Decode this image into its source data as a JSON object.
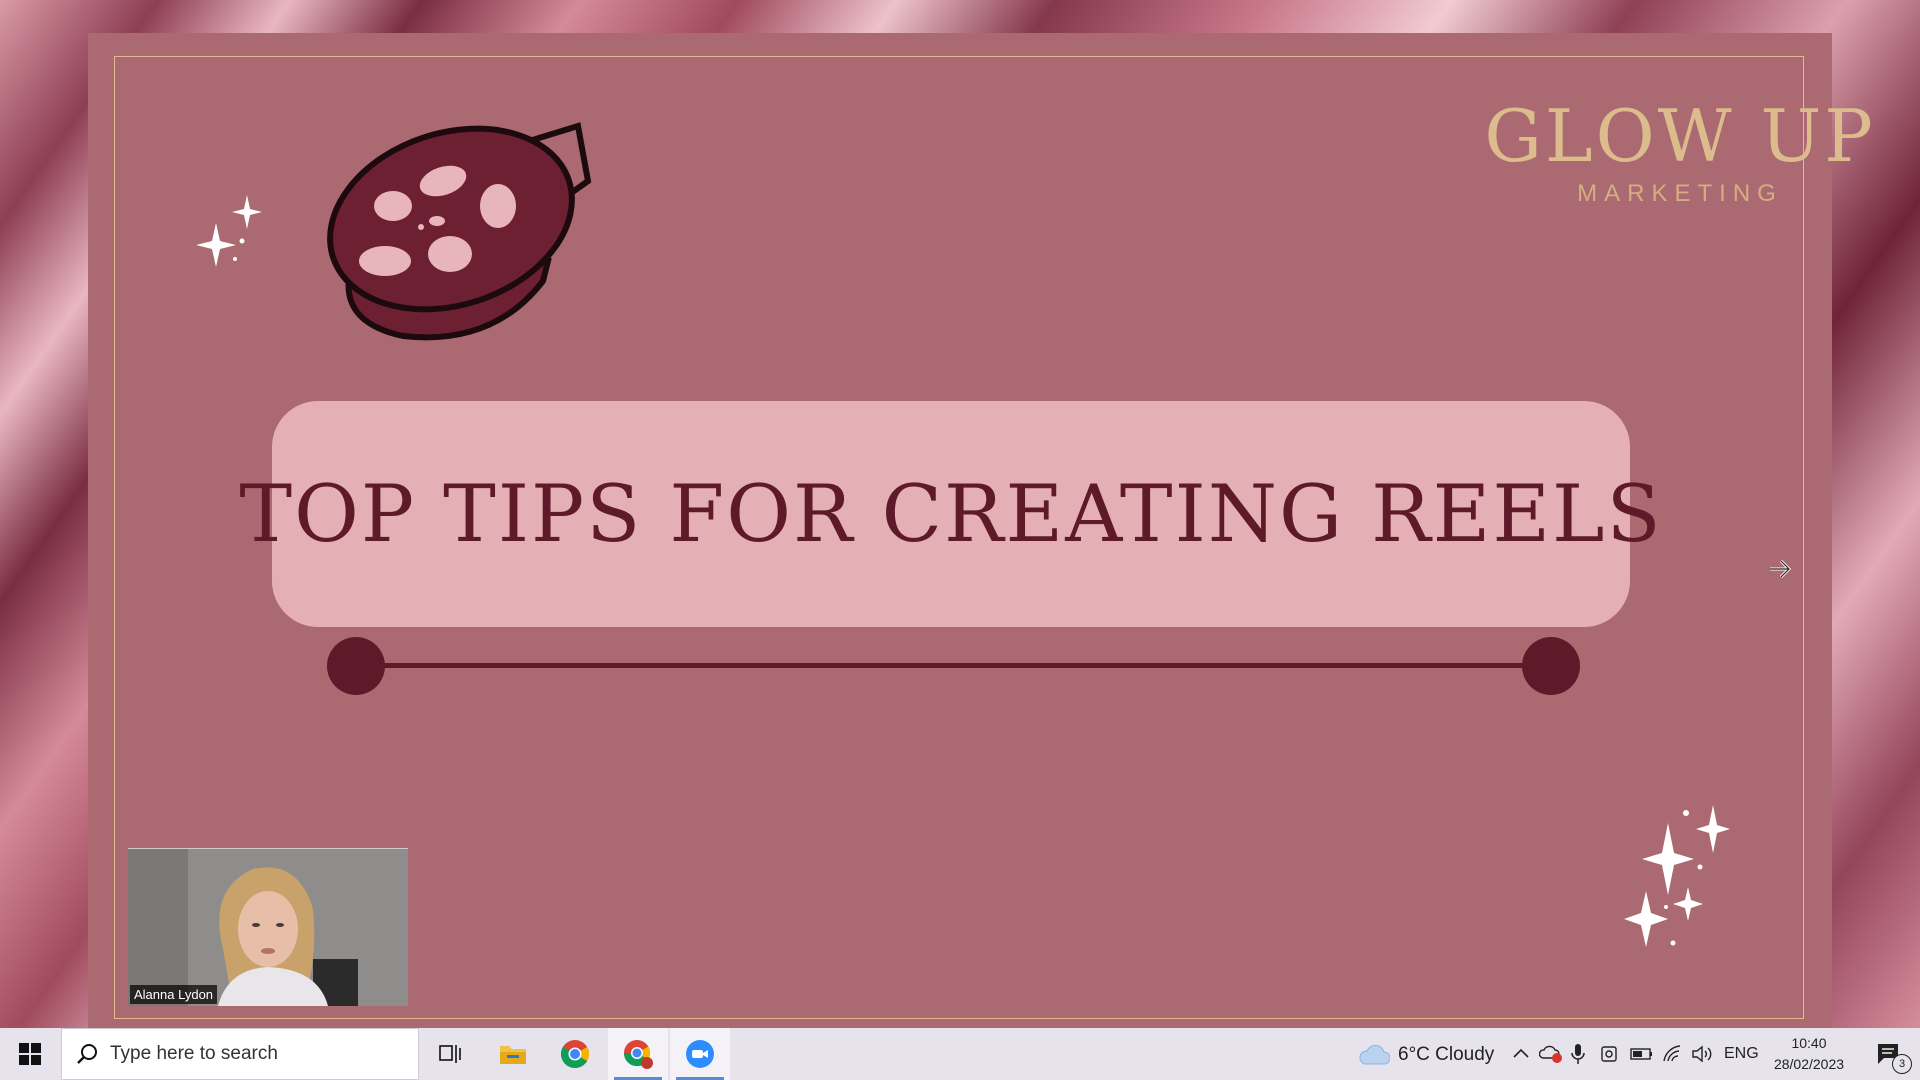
{
  "slide": {
    "logo_title": "GLOW UP",
    "logo_subtitle": "MARKETING",
    "title": "TOP TIPS FOR CREATING REELS"
  },
  "webcam": {
    "participant_name": "Alanna Lydon"
  },
  "taskbar": {
    "search_placeholder": "Type here to search",
    "apps": [
      "task-view",
      "file-explorer",
      "chrome",
      "chrome-profile",
      "zoom"
    ],
    "weather": "6°C  Cloudy",
    "language": "ENG",
    "time": "10:40",
    "date": "28/02/2023",
    "notification_count": "3"
  },
  "colors": {
    "slide_bg": "#ab6a72",
    "title_box": "#e5b0b5",
    "accent_dark": "#5e1a29",
    "gold": "#dcbb8c"
  }
}
